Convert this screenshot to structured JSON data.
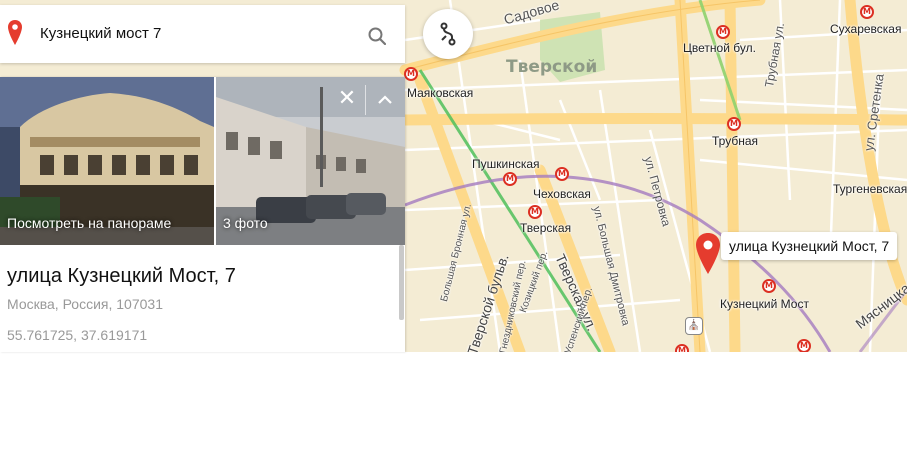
{
  "search": {
    "value": "Кузнецкий мост 7"
  },
  "map": {
    "district": "Тверской",
    "top_street": "Садовое",
    "streets": [
      "ул. Петровка",
      "Трубная ул.",
      "ул. Сретенка",
      "Большая Бронная ул.",
      "Тверской бульв.",
      "Тверская ул.",
      "ул. Большая Дмитровка",
      "Козицкий пер.",
      "Мясницкая",
      "Успенский пер.",
      "Гнездниковский пер."
    ],
    "metro_stations": [
      "Цветной бул.",
      "Сухаревская",
      "Трубная",
      "Тургеневская",
      "Пушкинская",
      "Чеховская",
      "Тверская",
      "Кузнецкий Мост",
      "Маяковская"
    ],
    "pin_label": "улица Кузнецкий Мост, 7"
  },
  "panel": {
    "photo1_caption": "Посмотреть на панораме",
    "photo2_caption": "3 фото",
    "address": "улица Кузнецкий Мост, 7",
    "city": "Москва, Россия, 107031",
    "coordinates": "55.761725, 37.619171"
  },
  "colors": {
    "map_background": "#f4ecd4",
    "major_road": "#fddc8a",
    "metro_red": "#dc2f22",
    "metro_line_green": "#4fbf5a",
    "metro_line_purple": "#a47bbf",
    "pin_red": "#e53c2e"
  },
  "icons": [
    "map-pin-icon",
    "search-icon",
    "route-icon",
    "metro-icon",
    "close-icon",
    "chevron-up-icon",
    "church-icon"
  ]
}
